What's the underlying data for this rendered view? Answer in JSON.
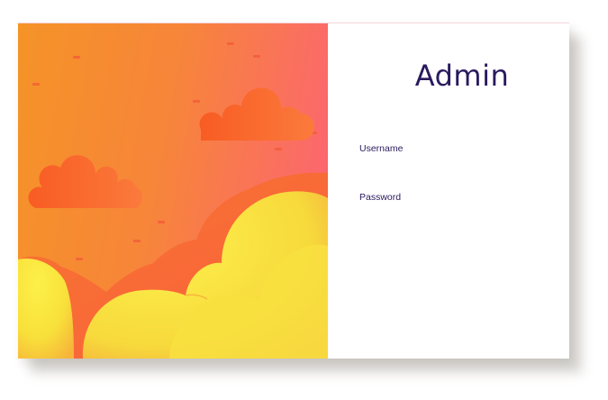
{
  "login": {
    "title": "Admin",
    "username_label": "Username",
    "username_value": "",
    "password_label": "Password",
    "password_value": ""
  },
  "colors": {
    "title_text": "#2a1a5e",
    "gradient_left": "#f59327",
    "gradient_right": "#fd5f7a",
    "cloud_orange": "#f9642d",
    "cloud_yellow": "#f8e43c"
  },
  "illustration": {
    "icons": [
      "cloud-icon",
      "cloud-icon",
      "sparkle-dash-icon"
    ]
  }
}
